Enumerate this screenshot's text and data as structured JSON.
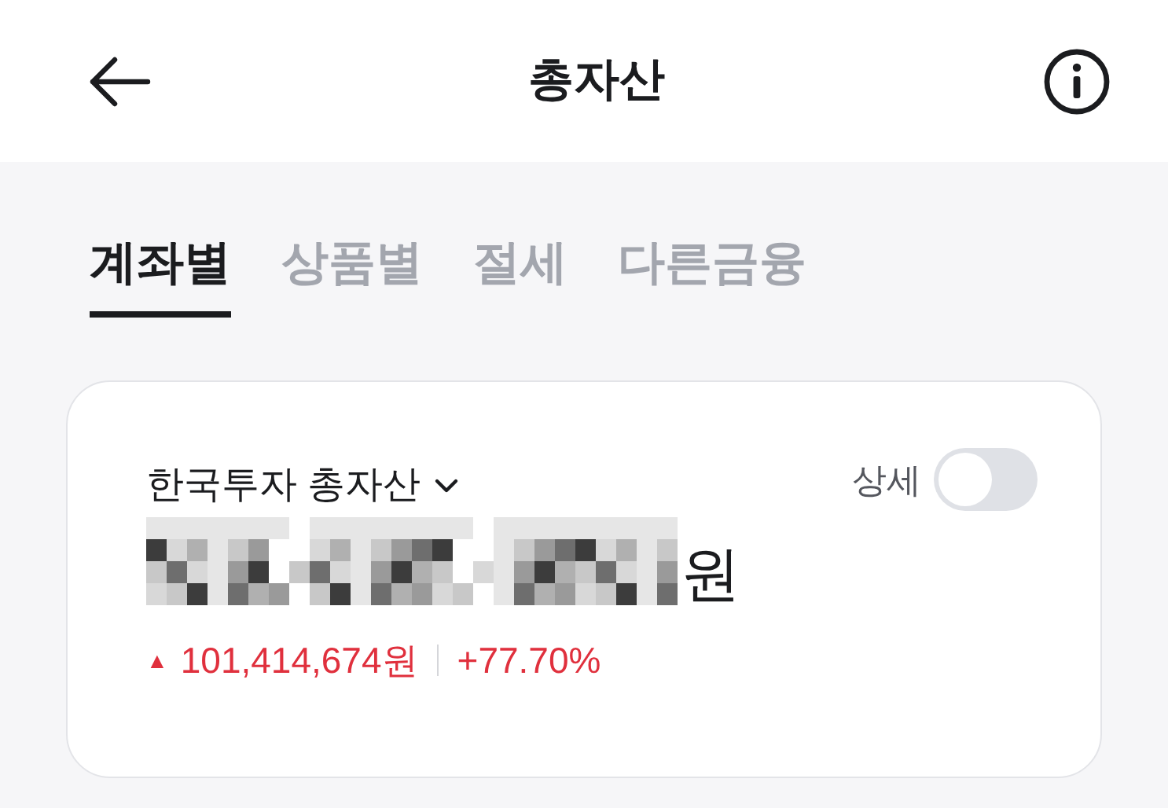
{
  "header": {
    "title": "총자산"
  },
  "tabs": [
    {
      "label": "계좌별",
      "selected": true
    },
    {
      "label": "상품별",
      "selected": false
    },
    {
      "label": "절세",
      "selected": false
    },
    {
      "label": "다른금융",
      "selected": false
    }
  ],
  "account_card": {
    "title": "한국투자 총자산",
    "detail_toggle": {
      "label": "상세",
      "on": false
    },
    "amount_unit": "원",
    "change": {
      "direction_icon": "▲",
      "amount": "101,414,674원",
      "rate": "+77.70%"
    }
  }
}
